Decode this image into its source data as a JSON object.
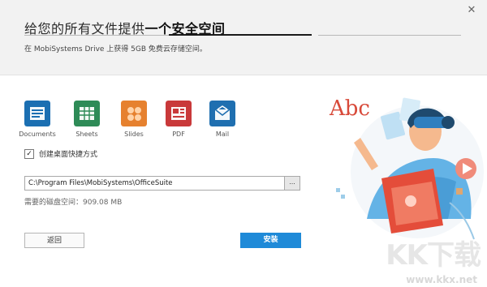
{
  "header": {
    "title_prefix": "给您的所有文件提供",
    "title_highlight": "一个安全空间",
    "subtitle": "在 MobiSystems Drive 上获得 5GB 免费云存储空间。"
  },
  "close_icon": "close-icon",
  "apps": [
    {
      "label": "Documents",
      "icon": "documents-icon",
      "color": "#1b6fb2"
    },
    {
      "label": "Sheets",
      "icon": "sheets-icon",
      "color": "#2e8b57"
    },
    {
      "label": "Slides",
      "icon": "slides-icon",
      "color": "#e6812f"
    },
    {
      "label": "PDF",
      "icon": "pdf-icon",
      "color": "#c9393a"
    },
    {
      "label": "Mail",
      "icon": "mail-icon",
      "color": "#1f6fb0"
    }
  ],
  "shortcut": {
    "label": "创建桌面快捷方式",
    "checked": true
  },
  "install_path": {
    "value": "C:\\Program Files\\MobiSystems\\OfficeSuite",
    "browse_label": "..."
  },
  "disk_space": "需要的磁盘空间：909.08 MB",
  "buttons": {
    "back": "返回",
    "install": "安装"
  },
  "illustration": {
    "letters": "Abc"
  },
  "watermark": {
    "logo": "KK下载",
    "url": "www.kkx.net"
  },
  "colors": {
    "accent": "#1f8ad8",
    "header_bg": "#f2f2f2"
  }
}
